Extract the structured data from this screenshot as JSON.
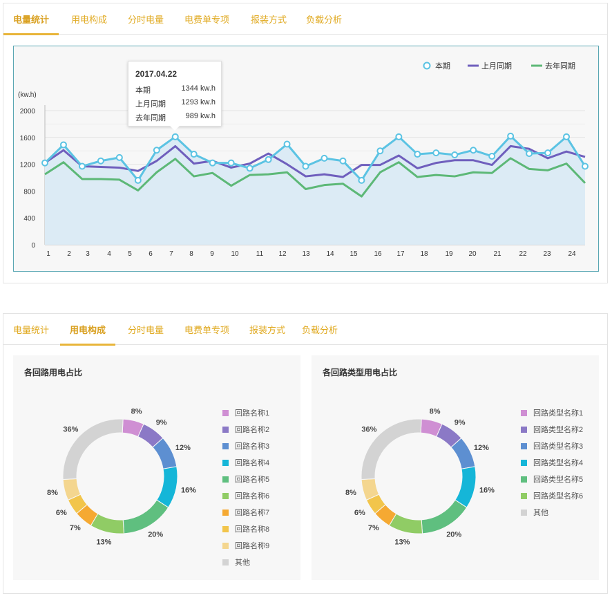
{
  "tabs1": [
    "电量统计",
    "用电构成",
    "分时电量",
    "电费单专项",
    "报装方式",
    "负载分析"
  ],
  "tabs2": [
    "电量统计",
    "用电构成",
    "分时电量",
    "电费单专项",
    "报装方式",
    "负载分析"
  ],
  "tooltip": {
    "date": "2017.04.22",
    "rows": [
      {
        "k": "本期",
        "v": "1344 kw.h"
      },
      {
        "k": "上月同期",
        "v": "1293 kw.h"
      },
      {
        "k": "去年同期",
        "v": "989 kw.h"
      }
    ]
  },
  "chart_data": [
    {
      "type": "line",
      "title": "",
      "ylabel": "(kw.h)",
      "ylim": [
        0,
        2000
      ],
      "yticks": [
        0,
        400,
        800,
        1200,
        1600,
        2000
      ],
      "x": [
        1,
        1.9,
        2.8,
        3.7,
        4.6,
        5.5,
        6.4,
        7.3,
        8.2,
        9.1,
        10,
        10.9,
        11.8,
        12.7,
        13.6,
        14.5,
        15.4,
        16.3,
        17.2,
        18.1,
        19,
        19.9,
        20.8,
        21.7,
        22.6,
        23.5,
        24.4
      ],
      "xticks": [
        "1",
        "2",
        "3",
        "4",
        "5",
        "6",
        "7",
        "8",
        "9",
        "10",
        "11",
        "12",
        "13",
        "14",
        "15",
        "16",
        "17",
        "18",
        "19",
        "20",
        "21",
        "22",
        "23",
        "24"
      ],
      "legend_position": "top-right",
      "grid": true,
      "series": [
        {
          "name": "本期",
          "color": "#5bc3e3",
          "area": true,
          "values": [
            1220,
            1490,
            1170,
            1250,
            1300,
            960,
            1410,
            1610,
            1350,
            1220,
            1220,
            1140,
            1270,
            1500,
            1170,
            1290,
            1250,
            960,
            1400,
            1610,
            1350,
            1370,
            1340,
            1410,
            1320,
            1620,
            1360,
            1370,
            1610,
            1170
          ]
        },
        {
          "name": "上月同期",
          "color": "#6f5fbd",
          "values": [
            1220,
            1410,
            1170,
            1160,
            1150,
            1100,
            1250,
            1470,
            1210,
            1250,
            1150,
            1210,
            1360,
            1200,
            1020,
            1050,
            1010,
            1190,
            1190,
            1330,
            1140,
            1220,
            1260,
            1260,
            1190,
            1470,
            1430,
            1290,
            1390,
            1310
          ]
        },
        {
          "name": "去年同期",
          "color": "#5db877",
          "values": [
            1050,
            1230,
            980,
            980,
            970,
            810,
            1080,
            1280,
            1020,
            1070,
            880,
            1040,
            1050,
            1080,
            830,
            890,
            910,
            720,
            1080,
            1230,
            1010,
            1040,
            1020,
            1080,
            1070,
            1290,
            1130,
            1110,
            1210,
            920
          ]
        }
      ]
    },
    {
      "type": "pie",
      "title": "各回路用电占比",
      "labels": [
        "回路名称1",
        "回路名称2",
        "回路名称3",
        "回路名称4",
        "回路名称5",
        "回路名称6",
        "回路名称7",
        "回路名称8",
        "回路名称9",
        "其他"
      ],
      "values": [
        8,
        9,
        12,
        16,
        20,
        13,
        7,
        6,
        8,
        36
      ],
      "colors": [
        "#cf8fd3",
        "#8b79c6",
        "#5d8fd1",
        "#15b6d8",
        "#5fbf7f",
        "#90cc65",
        "#f5a932",
        "#f2c54b",
        "#f4d68f",
        "#d3d3d3"
      ]
    },
    {
      "type": "pie",
      "title": "各回路类型用电占比",
      "labels": [
        "回路类型名称1",
        "回路类型名称2",
        "回路类型名称3",
        "回路类型名称4",
        "回路类型名称5",
        "回路类型名称6",
        "其他"
      ],
      "slice_labels": [
        "8%",
        "9%",
        "12%",
        "16%",
        "20%",
        "13%",
        "7%",
        "6%",
        "8%",
        "36%"
      ],
      "values": [
        8,
        9,
        12,
        16,
        20,
        13,
        7,
        6,
        8,
        36
      ],
      "colors": [
        "#cf8fd3",
        "#8b79c6",
        "#5d8fd1",
        "#15b6d8",
        "#5fbf7f",
        "#90cc65",
        "#f5a932",
        "#f2c54b",
        "#f4d68f",
        "#d3d3d3"
      ],
      "legend_colors": [
        "#cf8fd3",
        "#8b79c6",
        "#5d8fd1",
        "#15b6d8",
        "#5fbf7f",
        "#90cc65",
        "#d3d3d3"
      ]
    }
  ]
}
